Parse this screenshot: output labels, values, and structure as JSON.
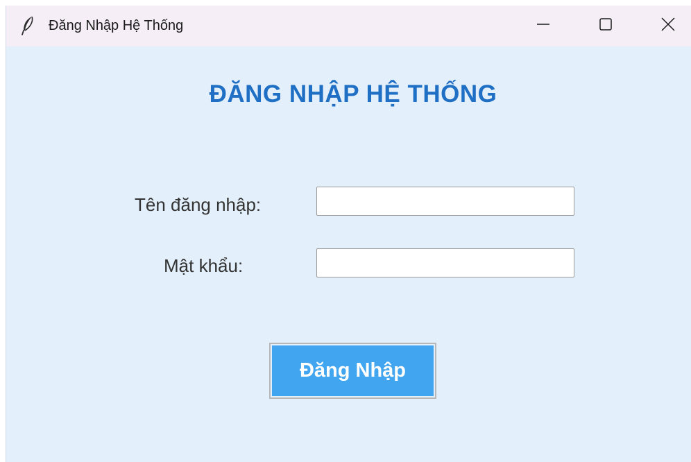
{
  "window": {
    "title": "Đăng Nhập Hệ Thống",
    "app_icon": "feather-icon",
    "controls": {
      "minimize": "minimize-icon",
      "maximize": "maximize-icon",
      "close": "close-icon"
    }
  },
  "form": {
    "heading": "ĐĂNG NHẬP HỆ THỐNG",
    "username_label": "Tên đăng nhập:",
    "username_value": "",
    "password_label": "Mật khẩu:",
    "password_value": "",
    "submit_label": "Đăng Nhập"
  },
  "colors": {
    "background": "#e3f0fb",
    "titlebar": "#f5eef7",
    "heading": "#1f6fc4",
    "button": "#42a5f0",
    "button_text": "#ffffff"
  }
}
